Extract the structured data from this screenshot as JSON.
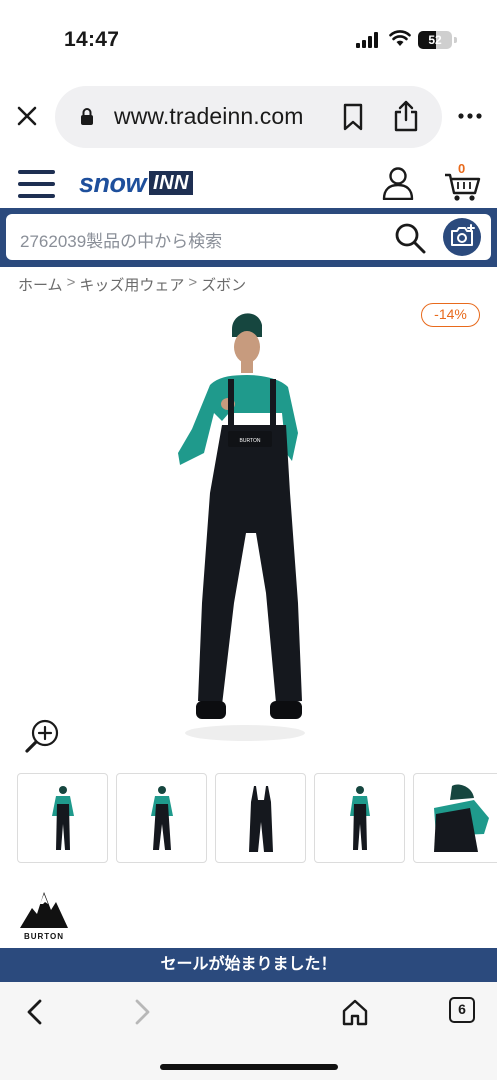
{
  "status_bar": {
    "time": "14:47",
    "battery": "52",
    "battery_level": 0.52
  },
  "browser": {
    "url": "www.tradeinn.com"
  },
  "site": {
    "logo_snow": "snow",
    "logo_inn": "INN",
    "cart_count": "0",
    "search_placeholder": "2762039製品の中から検索"
  },
  "breadcrumb": [
    "ホーム",
    "キッズ用ウェア",
    "ズボン"
  ],
  "breadcrumb_separator": ">",
  "product": {
    "discount": "-14%",
    "brand": "BURTON",
    "chest_logo": "BURTON"
  },
  "sale_banner": "セールが始まりました！",
  "bottom_nav": {
    "tabs_count": "6"
  },
  "colors": {
    "navy": "#2b4a7d",
    "dark_navy": "#1e2f52",
    "accent_orange": "#e86a1c",
    "teal": "#1f9a8c"
  }
}
